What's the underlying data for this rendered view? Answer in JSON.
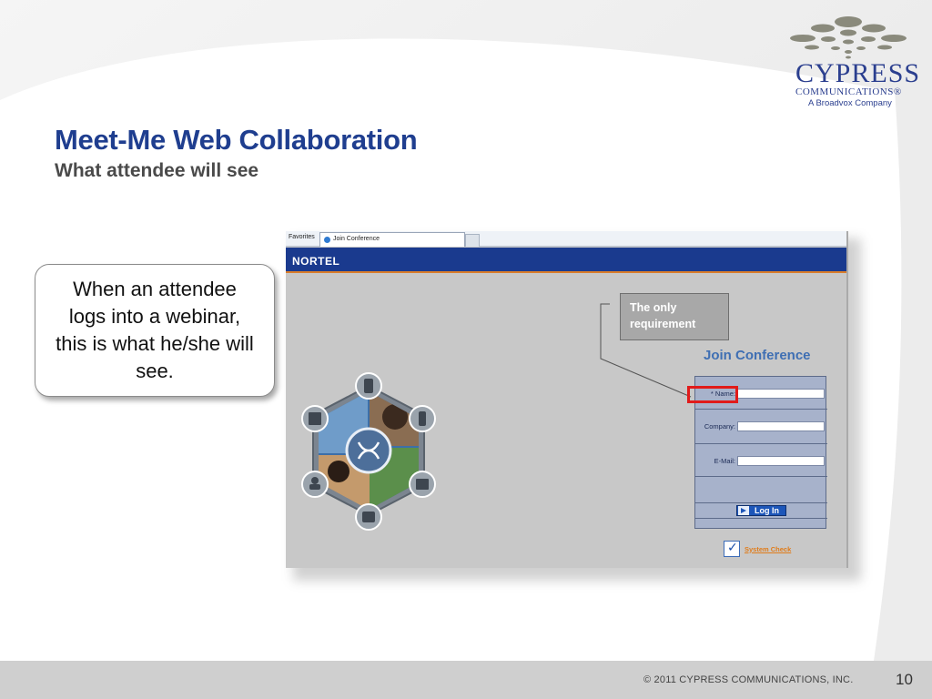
{
  "slide": {
    "title": "Meet-Me Web Collaboration",
    "subtitle": "What attendee will see",
    "callout_text": "When an attendee logs into a webinar, this is what he/she will see.",
    "footer_copyright": "© 2011 CYPRESS COMMUNICATIONS, INC.",
    "page_number": "10"
  },
  "logo": {
    "word": "CYPRESS",
    "line1": "COMMUNICATIONS®",
    "line2": "A Broadvox Company",
    "color": "#2b3f8f"
  },
  "screenshot": {
    "browser": {
      "favorites_label": "Favorites",
      "tab_label": "Join Conference"
    },
    "header_logo": "NORTEL",
    "note": "The only requirement",
    "join_title": "Join Conference",
    "form": {
      "name_label": "* Name:",
      "company_label": "Company:",
      "email_label": "E-Mail:",
      "login_label": "Log In"
    },
    "system_check_label": "System Check"
  },
  "colors": {
    "title": "#1f3e8f",
    "nortel_bar": "#1a3a8e",
    "highlight": "#e11b1b",
    "link": "#e07c1a"
  }
}
